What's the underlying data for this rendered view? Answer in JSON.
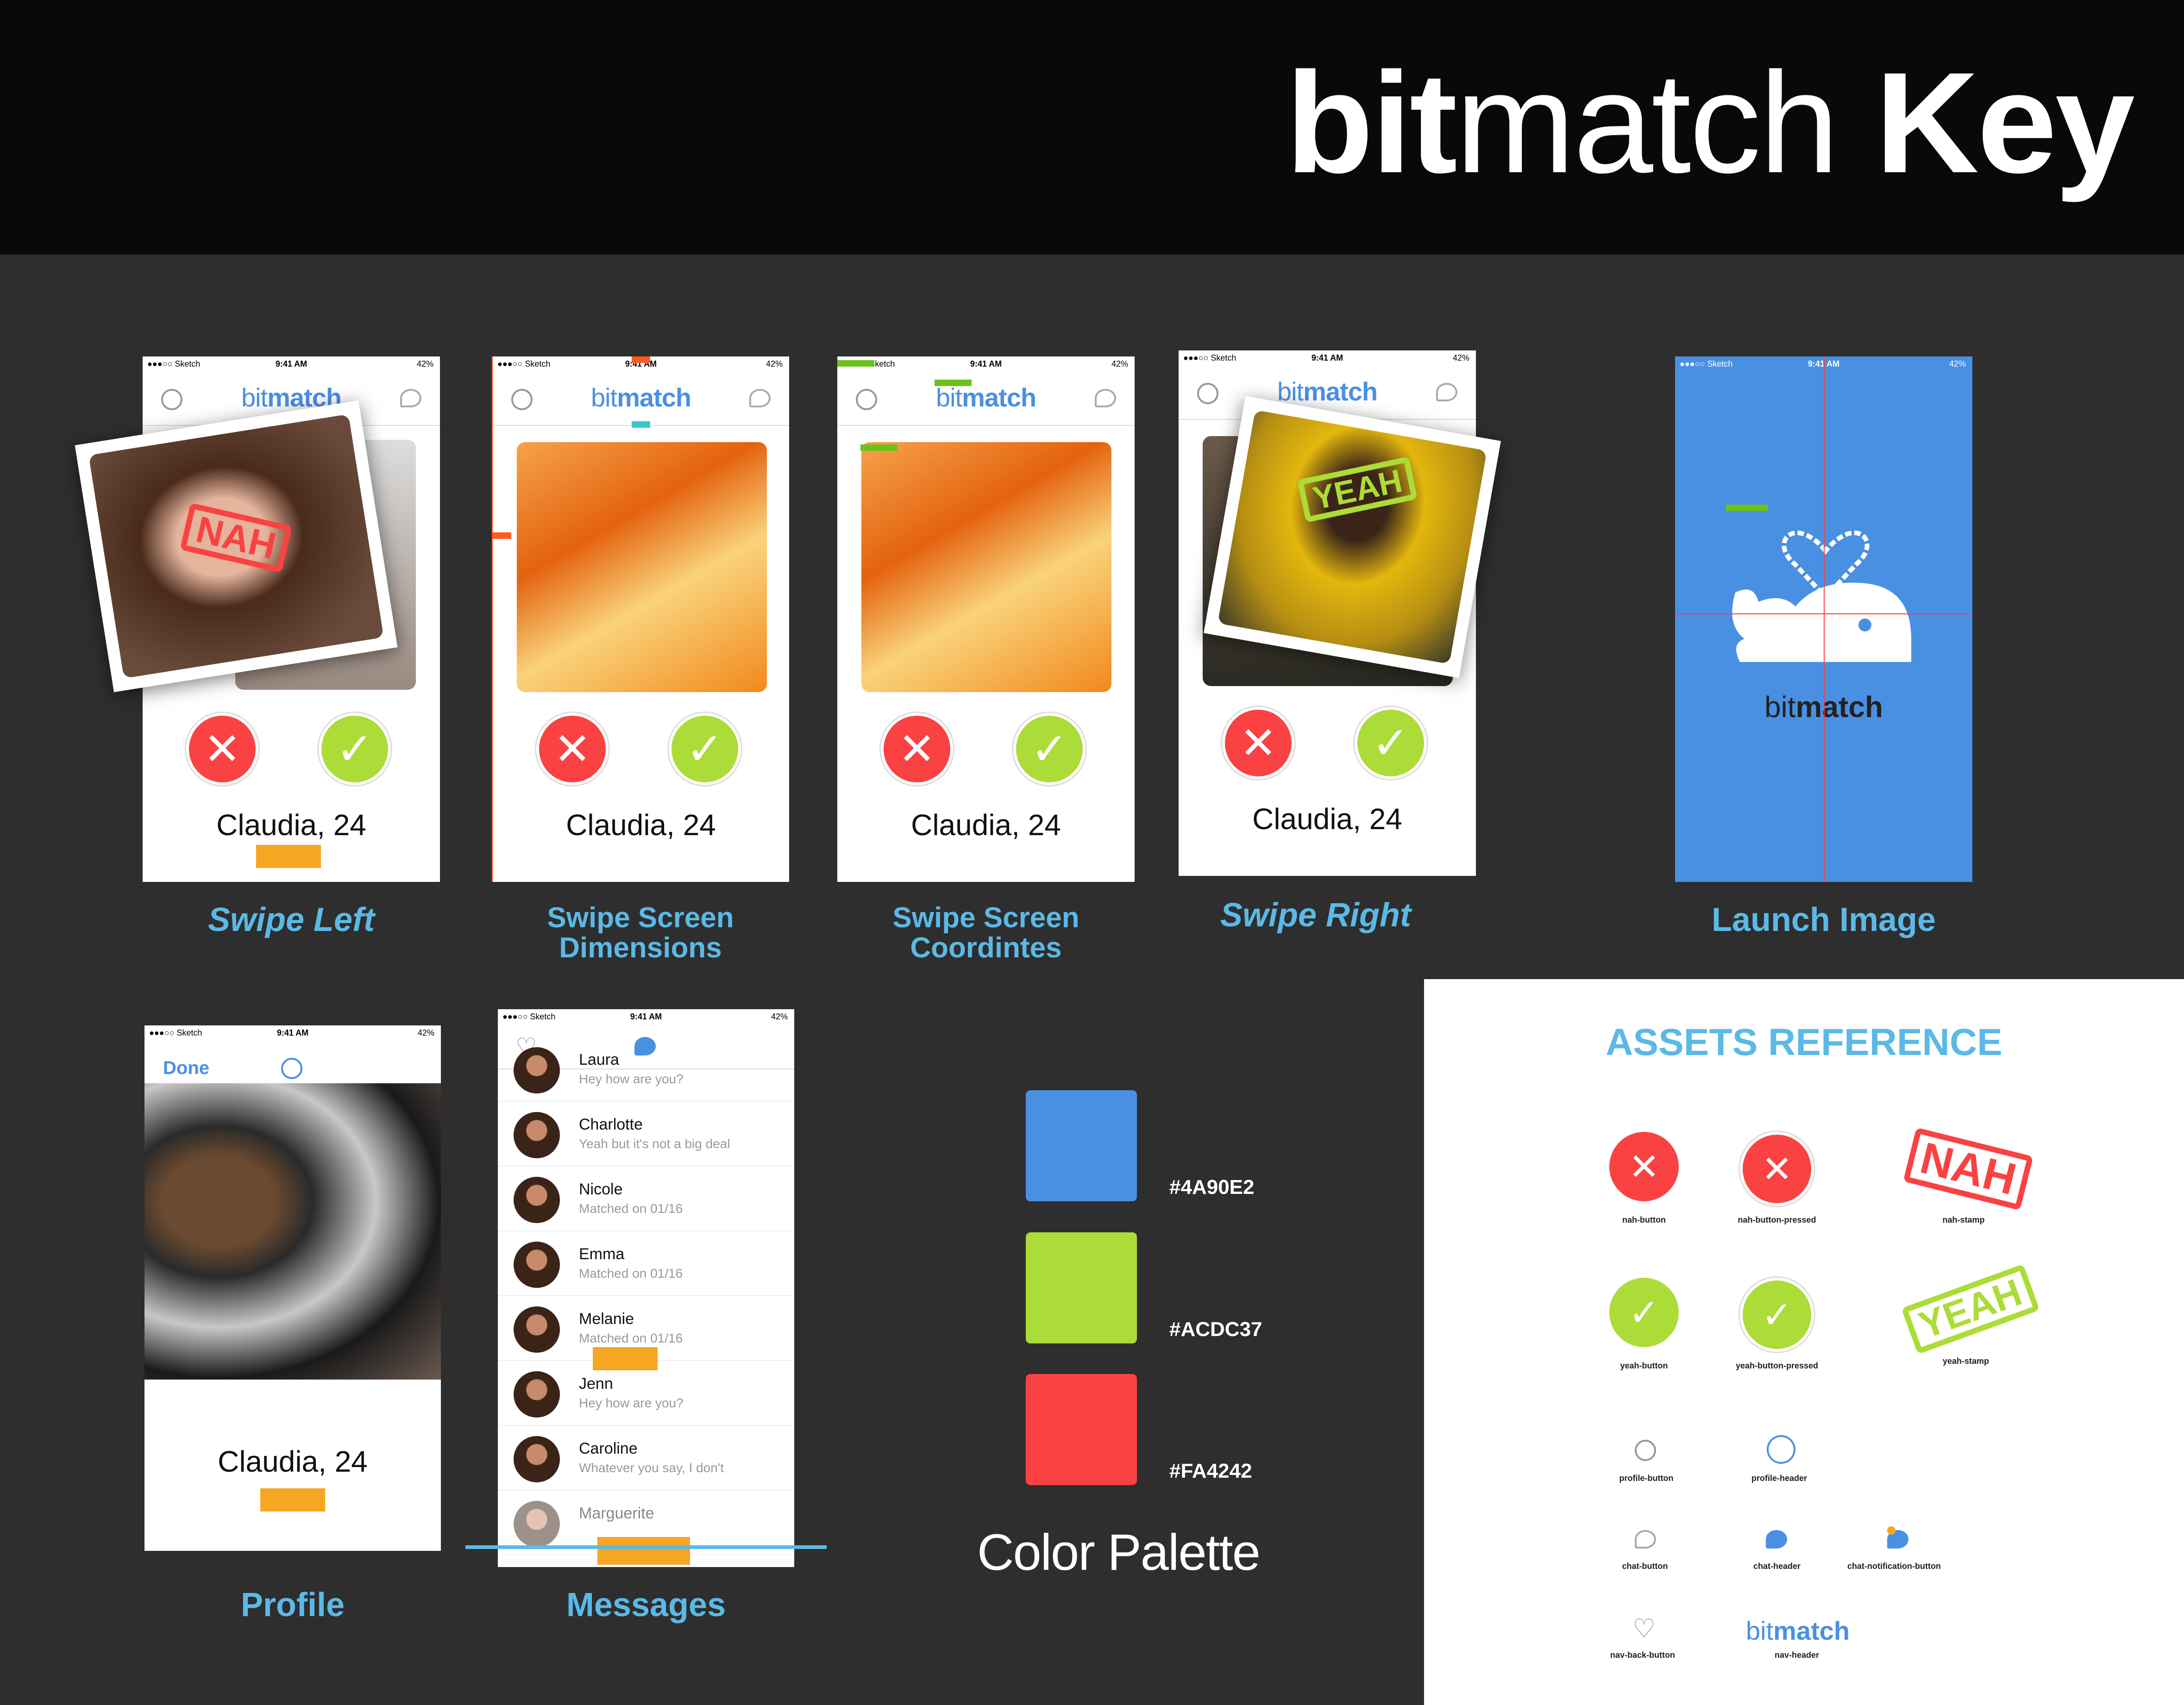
{
  "header": {
    "title_bold1": "bit",
    "title_light": "match",
    "title_bold2": "Key"
  },
  "status": {
    "carrier": "●●●○○ Sketch ",
    "time": "9:41 AM",
    "battery": "42%"
  },
  "logo": {
    "light": "bit",
    "bold": "match"
  },
  "icons": {
    "nah": "✕",
    "yeah": "✓",
    "heart": "♡"
  },
  "colors": {
    "blue": "#4A90E2",
    "green": "#ACDC37",
    "red": "#FA4242"
  },
  "screens": {
    "swipe_left": {
      "caption": "Swipe Left",
      "name": "Claudia, 24",
      "stamp": "NAH"
    },
    "dimensions": {
      "caption_line1": "Swipe Screen",
      "caption_line2": "Dimensions",
      "name": "Claudia, 24"
    },
    "coordinates": {
      "caption_line1": "Swipe Screen",
      "caption_line2": "Coordintes",
      "name": "Claudia, 24"
    },
    "swipe_right": {
      "caption": "Swipe Right",
      "name": "Claudia, 24",
      "stamp": "YEAH"
    },
    "launch": {
      "caption": "Launch Image",
      "logo_light": "bit",
      "logo_bold": "match"
    },
    "profile": {
      "caption": "Profile",
      "done": "Done",
      "name": "Claudia, 24"
    },
    "messages": {
      "caption": "Messages",
      "rows": [
        {
          "name": "Laura",
          "text": "Hey how are you?"
        },
        {
          "name": "Charlotte",
          "text": "Yeah but it's not a big deal"
        },
        {
          "name": "Nicole",
          "text": "Matched on 01/16"
        },
        {
          "name": "Emma",
          "text": "Matched on 01/16"
        },
        {
          "name": "Melanie",
          "text": "Matched on 01/16"
        },
        {
          "name": "Jenn",
          "text": "Hey how are you?"
        },
        {
          "name": "Caroline",
          "text": "Whatever you say, I don't"
        },
        {
          "name": "Marguerite",
          "text": ""
        }
      ]
    }
  },
  "palette": {
    "caption": "Color Palette",
    "blue": "#4A90E2",
    "green": "#ACDC37",
    "red": "#FA4242"
  },
  "assets": {
    "title": "ASSETS REFERENCE",
    "nah_button": "nah-button",
    "nah_button_pressed": "nah-button-pressed",
    "nah_stamp": "nah-stamp",
    "yeah_button": "yeah-button",
    "yeah_button_pressed": "yeah-button-pressed",
    "yeah_stamp": "yeah-stamp",
    "profile_button": "profile-button",
    "profile_header": "profile-header",
    "chat_button": "chat-button",
    "chat_header": "chat-header",
    "chat_notification_button": "chat-notification-button",
    "nav_back_button": "nav-back-button",
    "nav_header": "nav-header",
    "nah_text": "NAH",
    "yeah_text": "YEAH",
    "logo_light": "bit",
    "logo_bold": "match"
  }
}
